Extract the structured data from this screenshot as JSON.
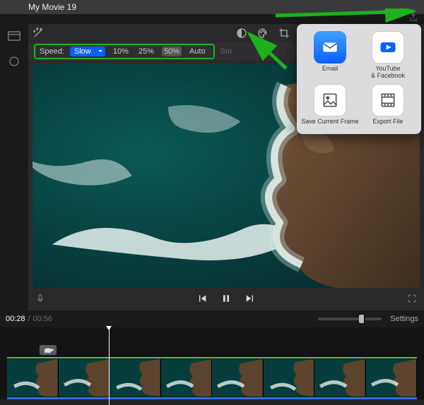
{
  "title": "My Movie 19",
  "speed": {
    "label": "Speed:",
    "selected": "Slow",
    "pct10": "10%",
    "pct25": "25%",
    "pct50": "50%",
    "auto": "Auto",
    "smLabel": "Sm"
  },
  "time": {
    "current": "00:28",
    "sep": " / ",
    "total": "00:56"
  },
  "settings": "Settings",
  "share": {
    "email": "Email",
    "youtube": "YouTube\n& Facebook",
    "saveframe": "Save Current Frame",
    "exportfile": "Export File"
  }
}
